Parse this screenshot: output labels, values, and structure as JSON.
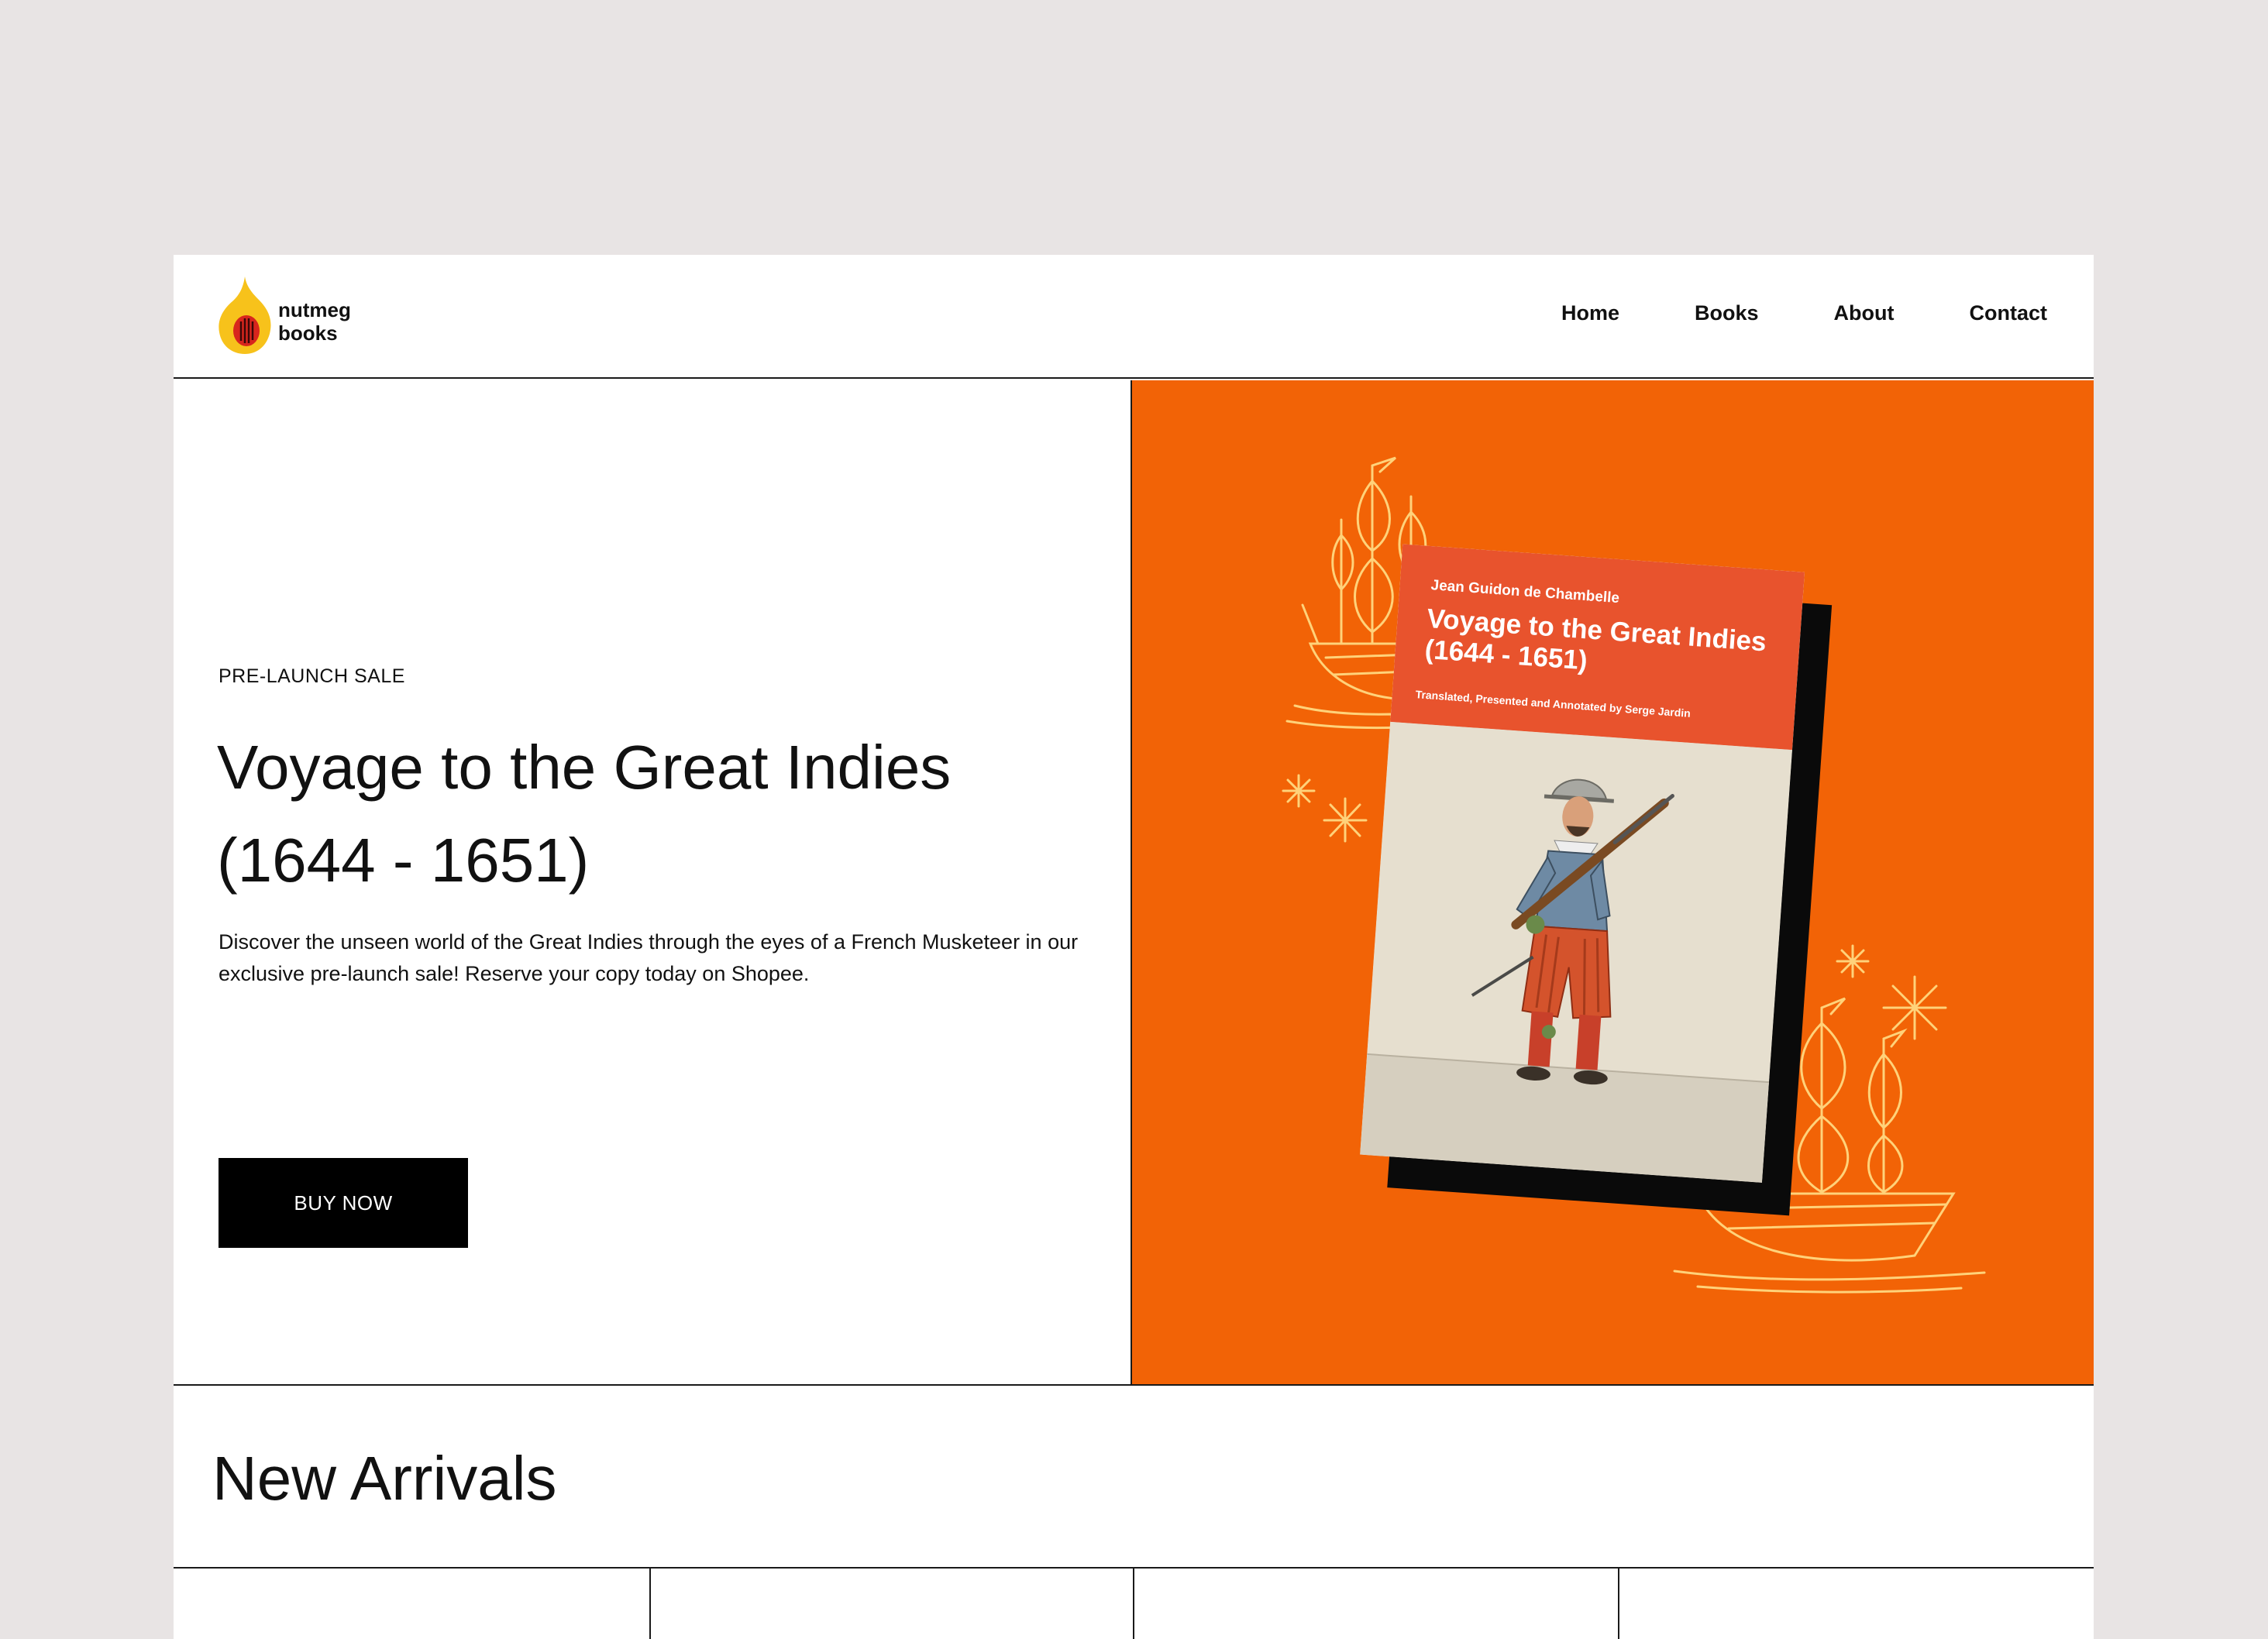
{
  "brand": {
    "name": "nutmeg\nbooks",
    "colors": {
      "accent": "#f26306",
      "logo_yellow": "#f7c21b",
      "logo_red": "#d8261d",
      "cover_red": "#e8532d",
      "deco_line": "#ffd27a"
    }
  },
  "nav": {
    "items": [
      {
        "label": "Home"
      },
      {
        "label": "Books"
      },
      {
        "label": "About"
      },
      {
        "label": "Contact"
      }
    ]
  },
  "hero": {
    "eyebrow": "PRE-LAUNCH SALE",
    "title": "Voyage to the Great Indies (1644 - 1651)",
    "description": "Discover the unseen world of the Great Indies through the eyes of a French Musketeer in our exclusive pre-launch sale! Reserve your copy today on Shopee.",
    "cta_label": "BUY NOW"
  },
  "book": {
    "author": "Jean Guidon de Chambelle",
    "title": "Voyage to the Great Indies\n(1644 - 1651)",
    "credit": "Translated, Presented and Annotated by Serge Jardin",
    "icons": [
      "ship-illustration-icon",
      "sparkle-icon",
      "musketeer-illustration"
    ]
  },
  "new_arrivals": {
    "title": "New Arrivals"
  }
}
